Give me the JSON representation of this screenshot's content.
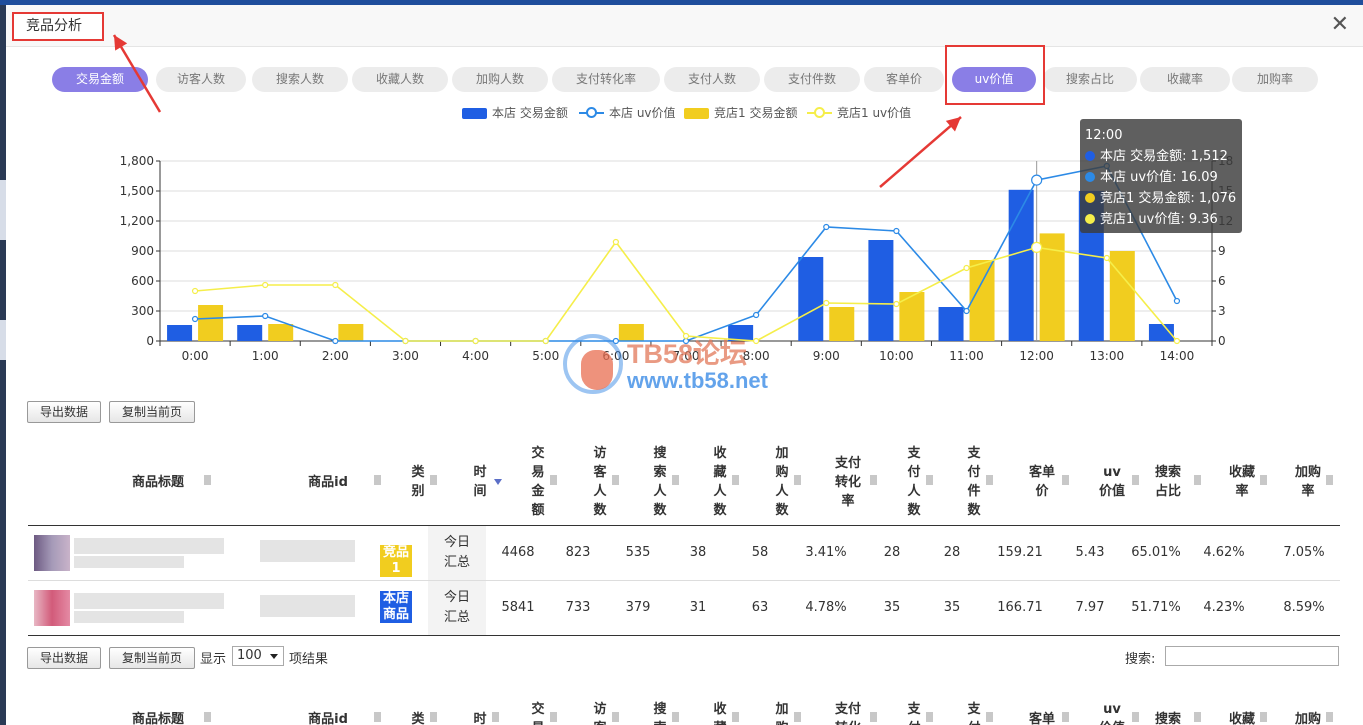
{
  "modal": {
    "title": "竞品分析",
    "close_icon": "close-icon"
  },
  "tabs": [
    "交易金额",
    "访客人数",
    "搜索人数",
    "收藏人数",
    "加购人数",
    "支付转化率",
    "支付人数",
    "支付件数",
    "客单价",
    "uv价值",
    "搜索占比",
    "收藏率",
    "加购率"
  ],
  "active_tabs": [
    "交易金额",
    "uv价值"
  ],
  "colors": {
    "accent": "#8a7ee6",
    "store_bar": "#1f5ee3",
    "store_line": "#2c8ae6",
    "rival_bar": "#f1cd1f",
    "rival_line": "#f5ee4a",
    "annotation": "#e53935"
  },
  "legend": [
    "本店 交易金额",
    "本店 uv价值",
    "竞店1 交易金额",
    "竞店1 uv价值"
  ],
  "chart_data": {
    "type": "bar",
    "categories": [
      "0:00",
      "1:00",
      "2:00",
      "3:00",
      "4:00",
      "5:00",
      "6:00",
      "7:00",
      "8:00",
      "9:00",
      "10:00",
      "11:00",
      "12:00",
      "13:00",
      "14:00"
    ],
    "left_axis": {
      "ylim": [
        0,
        1800
      ],
      "ticks": [
        "0",
        "300",
        "600",
        "900",
        "1,200",
        "1,500",
        "1,800"
      ]
    },
    "right_axis": {
      "ylim": [
        0,
        18
      ],
      "ticks": [
        "0",
        "3",
        "6",
        "9",
        "12",
        "15",
        "18"
      ]
    },
    "series": [
      {
        "name": "本店 交易金额",
        "type": "bar",
        "axis": "left",
        "values": [
          160,
          160,
          0,
          0,
          0,
          0,
          0,
          0,
          160,
          840,
          1010,
          340,
          1512,
          1500,
          170
        ]
      },
      {
        "name": "竞店1 交易金额",
        "type": "bar",
        "axis": "left",
        "values": [
          360,
          170,
          170,
          0,
          0,
          0,
          170,
          0,
          0,
          340,
          490,
          810,
          1076,
          900,
          0
        ]
      },
      {
        "name": "本店 uv价值",
        "type": "line",
        "axis": "right",
        "values": [
          2.2,
          2.5,
          0,
          0,
          0,
          0,
          0,
          0,
          2.6,
          11.4,
          11,
          3,
          16.09,
          17.5,
          4
        ]
      },
      {
        "name": "竞店1 uv价值",
        "type": "line",
        "axis": "right",
        "values": [
          5,
          5.6,
          5.6,
          0,
          0,
          0,
          9.9,
          0.5,
          0,
          3.8,
          3.7,
          7.3,
          9.36,
          8.3,
          0
        ]
      }
    ],
    "grid": true,
    "legend_position": "top-center"
  },
  "tooltip": {
    "title": "12:00",
    "lines": [
      "本店 交易金额: 1,512",
      "本店 uv价值: 16.09",
      "竞店1 交易金额: 1,076",
      "竞店1 uv价值: 9.36"
    ]
  },
  "watermark": {
    "title": "TB58论坛",
    "url": "www.tb58.net"
  },
  "toolbar": {
    "export": "导出数据",
    "copy": "复制当前页"
  },
  "columns": [
    "商品标题",
    "商品id",
    "类\n别",
    "时\n间",
    "交\n易\n金\n额",
    "访\n客\n人\n数",
    "搜\n索\n人\n数",
    "收\n藏\n人\n数",
    "加\n购\n人\n数",
    "支付\n转化\n率",
    "支\n付\n人\n数",
    "支\n付\n件\n数",
    "客单\n价",
    "uv\n价值",
    "搜索\n占比",
    "收藏\n率",
    "加购\n率"
  ],
  "rows": [
    {
      "category": "竞品1",
      "time": "今日\n汇总",
      "values": [
        "4468",
        "823",
        "535",
        "38",
        "58",
        "3.41%",
        "28",
        "28",
        "159.21",
        "5.43",
        "65.01%",
        "4.62%",
        "7.05%"
      ]
    },
    {
      "category": "本店\n商品",
      "time": "今日\n汇总",
      "values": [
        "5841",
        "733",
        "379",
        "31",
        "63",
        "4.78%",
        "35",
        "35",
        "166.71",
        "7.97",
        "51.71%",
        "4.23%",
        "8.59%"
      ]
    }
  ],
  "pager": {
    "show_label": "显示",
    "page_size": "100",
    "result_label": "项结果",
    "search_label": "搜索:"
  },
  "columns_bottom": [
    "商品标题",
    "商品id",
    "类",
    "时间",
    "交\n易",
    "访\n客",
    "搜\n索",
    "收\n藏",
    "加\n购",
    "支付\n转化",
    "支\n付",
    "支\n付",
    "客单",
    "uv\n价值",
    "搜索",
    "收藏",
    "加购"
  ]
}
